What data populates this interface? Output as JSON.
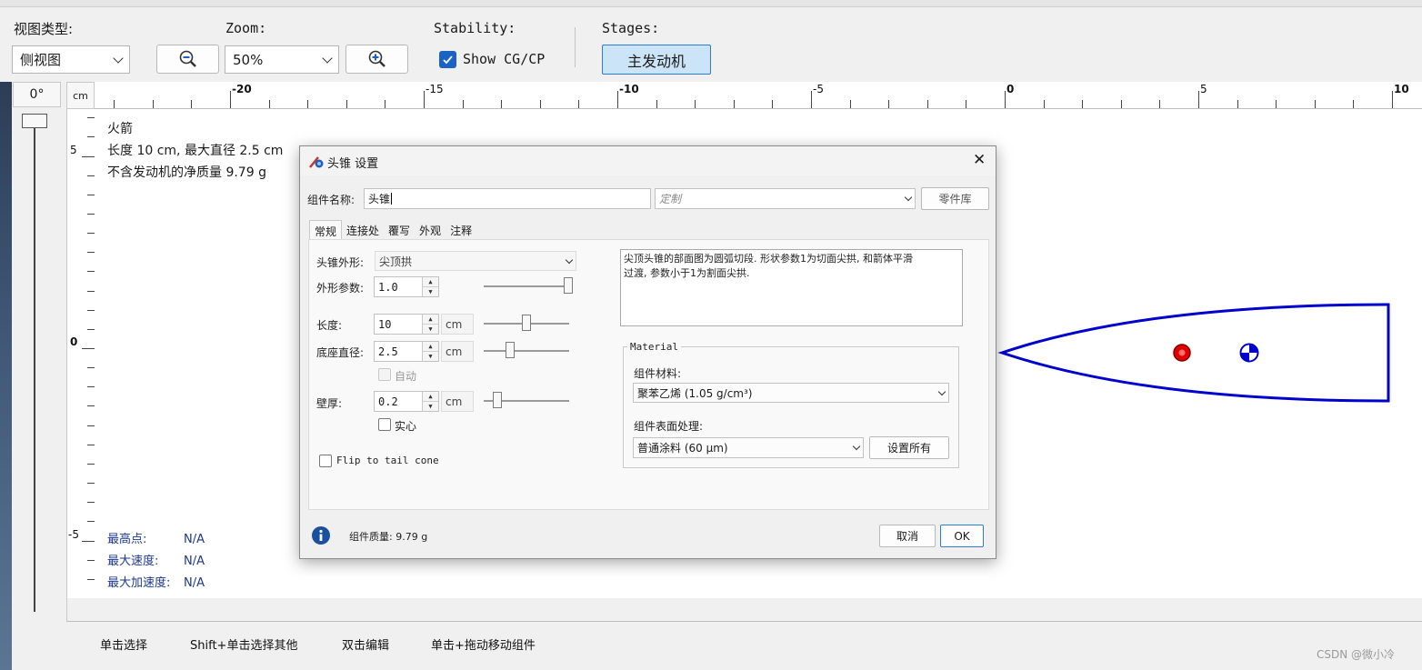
{
  "toolbar": {
    "view_type_label": "视图类型:",
    "view_type_value": "侧视图",
    "zoom_label": "Zoom:",
    "zoom_value": "50%",
    "stability_label": "Stability:",
    "show_cgcp_label": "Show CG/CP",
    "show_cgcp_checked": true,
    "stages_label": "Stages:",
    "stage_button": "主发动机"
  },
  "canvas": {
    "rotation": "0°",
    "ruler_unit": "cm",
    "h_ruler_labels": [
      "-20",
      "-15",
      "-10",
      "-5",
      "0",
      "5",
      "10"
    ],
    "v_ruler_labels": [
      "5",
      "0",
      "-5"
    ],
    "rocket_name": "火箭",
    "rocket_dims": "长度 10 cm, 最大直径 2.5 cm",
    "rocket_mass": "不含发动机的净质量 9.79 g",
    "stats": [
      {
        "label": "最高点:",
        "value": "N/A"
      },
      {
        "label": "最大速度:",
        "value": "N/A"
      },
      {
        "label": "最大加速度:",
        "value": "N/A"
      }
    ],
    "cg_color": "#e00000",
    "outline_color": "#0000cc"
  },
  "dialog": {
    "title": "头锥 设置",
    "close_glyph": "✕",
    "component_name_label": "组件名称:",
    "component_name_value": "头锥",
    "preset_value": "定制",
    "library_button": "零件库",
    "tabs": [
      "常规",
      "连接处",
      "覆写",
      "外观",
      "注释"
    ],
    "active_tab": "常规",
    "shape_label": "头锥外形:",
    "shape_value": "尖顶拱",
    "shape_param_label": "外形参数:",
    "shape_param_value": "1.0",
    "length_label": "长度:",
    "length_value": "10",
    "length_unit": "cm",
    "base_diameter_label": "底座直径:",
    "base_diameter_value": "2.5",
    "base_diameter_unit": "cm",
    "auto_label": "自动",
    "wall_label": "壁厚:",
    "wall_value": "0.2",
    "wall_unit": "cm",
    "solid_label": "实心",
    "flip_label": "Flip to tail cone",
    "description_line1": "尖顶头锥的部面图为圆弧切段. 形状参数1为切面尖拱, 和箭体平滑",
    "description_line2": "过渡, 参数小于1为割面尖拱.",
    "material_group": "Material",
    "material_label": "组件材料:",
    "material_value": "聚苯乙烯 (1.05 g/cm³)",
    "finish_label": "组件表面处理:",
    "finish_value": "普通涂料 (60 μm)",
    "set_all_button": "设置所有",
    "mass_text": "组件质量: 9.79 g",
    "cancel_button": "取消",
    "ok_button": "OK"
  },
  "statusbar": {
    "hints": [
      "单击选择",
      "Shift+单击选择其他",
      "双击编辑",
      "单击+拖动移动组件"
    ],
    "watermark": "CSDN @微小冷"
  }
}
